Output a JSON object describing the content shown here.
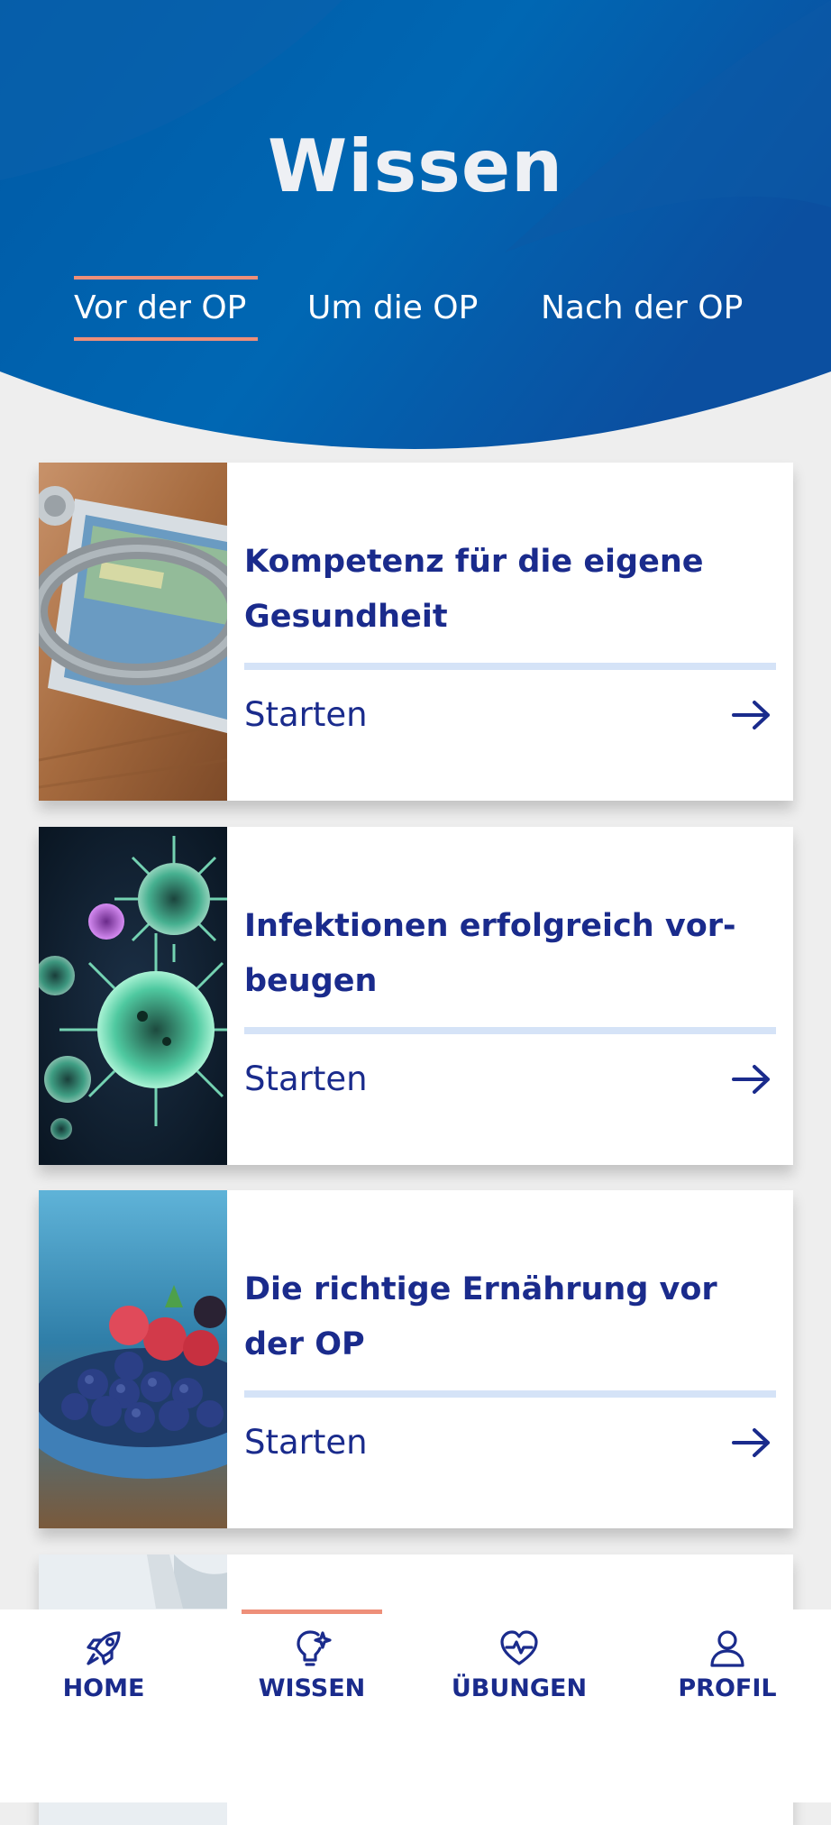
{
  "header": {
    "title": "Wissen",
    "tabs": [
      "Vor der OP",
      "Um die OP",
      "Nach der OP"
    ],
    "active_tab": "Vor der OP"
  },
  "cards": [
    {
      "title": "Kompetenz für die eigene Gesundheit",
      "action": "Starten",
      "image": "stethoscope-tablet-photo"
    },
    {
      "title": "Infektionen erfolgreich vor-beugen",
      "action": "Starten",
      "image": "virus-photo"
    },
    {
      "title": "Die richtige Ernährung vor der OP",
      "action": "Starten",
      "image": "berries-bowl-photo"
    },
    {
      "title": "",
      "action": "",
      "image": "doctor-photo"
    }
  ],
  "bottom_nav": {
    "items": [
      {
        "label": "HOME",
        "icon": "rocket-icon"
      },
      {
        "label": "WISSEN",
        "icon": "lightbulb-icon"
      },
      {
        "label": "ÜBUNGEN",
        "icon": "heart-pulse-icon"
      },
      {
        "label": "PROFIL",
        "icon": "user-icon"
      }
    ],
    "active": "WISSEN"
  },
  "colors": {
    "header_blue": "#0062ad",
    "accent_coral": "#ee8f79",
    "text_navy": "#1a2b8c",
    "divider_light_blue": "#d5e3f7",
    "background": "#eeeeee"
  }
}
